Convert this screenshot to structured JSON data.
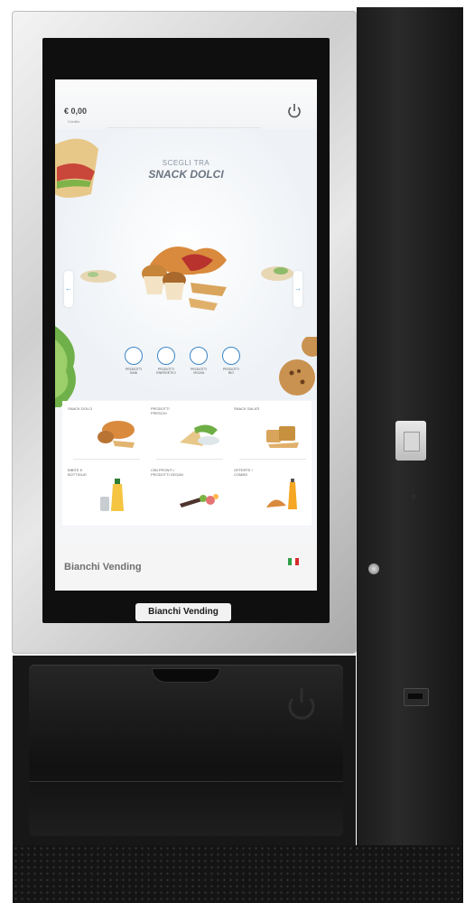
{
  "screen": {
    "credit": {
      "amount": "€ 0,00",
      "label": "Credito"
    },
    "power_icon": "power-icon",
    "header": {
      "subtitle": "SCEGLI TRA",
      "title": "SNACK DOLCI"
    },
    "carousel": {
      "prev_label": "←",
      "next_label": "→"
    },
    "diet_filters": [
      {
        "label": "PRODOTTI SANI",
        "icon": "leaf-icon"
      },
      {
        "label": "PRODOTTI ENERGETICI",
        "icon": "lightning-icon"
      },
      {
        "label": "PRODOTTI VEGAN",
        "icon": "vegan-icon"
      },
      {
        "label": "PRODOTTI BIO",
        "icon": "bio-icon"
      }
    ],
    "categories": [
      {
        "label": "SNACK DOLCI",
        "icon": "pastry-icon"
      },
      {
        "label": "PRODOTTI FRESCHI",
        "icon": "sandwich-icon"
      },
      {
        "label": "SNACK SALATI",
        "icon": "crackers-icon"
      },
      {
        "label": "BIBITE E BOTTIGLIE",
        "icon": "bottle-icon"
      },
      {
        "label": "CIBI PRONTI / PRODOTTI VEGAN",
        "icon": "vegetables-icon"
      },
      {
        "label": "OFFERTE / COMBO",
        "icon": "combo-icon"
      }
    ],
    "footer": {
      "brand": "Bianchi Vending",
      "language_flag": "italy-flag-icon"
    }
  },
  "machine": {
    "brand_plate": "Bianchi Vending"
  },
  "colors": {
    "accent_blue": "#3a86c8",
    "flag_green": "#2e9e47",
    "flag_white": "#ffffff",
    "flag_red": "#d62b2b"
  }
}
